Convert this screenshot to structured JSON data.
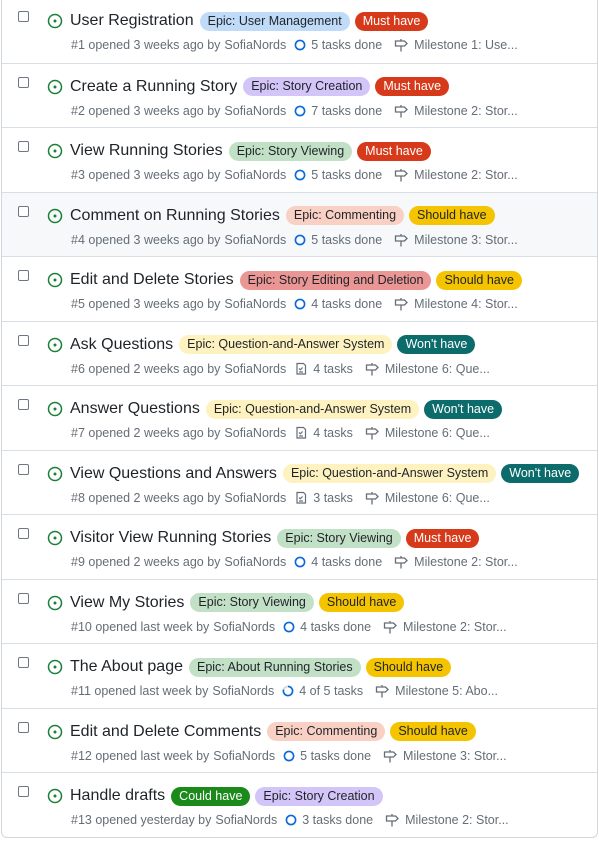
{
  "colors": {
    "open": "#1a7f37",
    "must": "#d73a1a",
    "should": "#f5c400",
    "wont": "#0c6b6b",
    "could": "#1b8a1b",
    "epic_user_mgmt": "#bfdbf7",
    "epic_story_creation": "#d4c5f9",
    "epic_story_viewing": "#c2e0c6",
    "epic_commenting": "#f9d0c4",
    "epic_editing_deletion": "#e99695",
    "epic_qa": "#fef2c0"
  },
  "issues": [
    {
      "title": "User Registration",
      "labels": [
        {
          "text": "Epic: User Management",
          "bg": "#bfdbf7",
          "fg": "#1f2328"
        },
        {
          "text": "Must have",
          "bg": "#d73a1a",
          "fg": "#ffffff"
        }
      ],
      "meta": "#1 opened 3 weeks ago by",
      "author": "SofiaNords",
      "tasks": "5 tasks done",
      "task_icon": "circle",
      "milestone": "Milestone 1: Use..."
    },
    {
      "title": "Create a Running Story",
      "labels": [
        {
          "text": "Epic: Story Creation",
          "bg": "#d4c5f9",
          "fg": "#1f2328"
        },
        {
          "text": "Must have",
          "bg": "#d73a1a",
          "fg": "#ffffff"
        }
      ],
      "meta": "#2 opened 3 weeks ago by",
      "author": "SofiaNords",
      "tasks": "7 tasks done",
      "task_icon": "circle",
      "milestone": "Milestone 2: Stor..."
    },
    {
      "title": "View Running Stories",
      "labels": [
        {
          "text": "Epic: Story Viewing",
          "bg": "#c2e0c6",
          "fg": "#1f2328"
        },
        {
          "text": "Must have",
          "bg": "#d73a1a",
          "fg": "#ffffff"
        }
      ],
      "meta": "#3 opened 3 weeks ago by",
      "author": "SofiaNords",
      "tasks": "5 tasks done",
      "task_icon": "circle",
      "milestone": "Milestone 2: Stor..."
    },
    {
      "title": "Comment on Running Stories",
      "labels": [
        {
          "text": "Epic: Commenting",
          "bg": "#f9d0c4",
          "fg": "#1f2328"
        },
        {
          "text": "Should have",
          "bg": "#f5c400",
          "fg": "#1f2328"
        }
      ],
      "meta": "#4 opened 3 weeks ago by",
      "author": "SofiaNords",
      "tasks": "5 tasks done",
      "task_icon": "circle",
      "milestone": "Milestone 3: Stor..."
    },
    {
      "title": "Edit and Delete Stories",
      "labels": [
        {
          "text": "Epic: Story Editing and Deletion",
          "bg": "#e99695",
          "fg": "#1f2328"
        },
        {
          "text": "Should have",
          "bg": "#f5c400",
          "fg": "#1f2328"
        }
      ],
      "meta": "#5 opened 3 weeks ago by",
      "author": "SofiaNords",
      "tasks": "4 tasks done",
      "task_icon": "circle",
      "milestone": "Milestone 4: Stor..."
    },
    {
      "title": "Ask Questions",
      "labels": [
        {
          "text": "Epic: Question-and-Answer System",
          "bg": "#fef2c0",
          "fg": "#1f2328"
        },
        {
          "text": "Won't have",
          "bg": "#0c6b6b",
          "fg": "#ffffff"
        }
      ],
      "meta": "#6 opened 2 weeks ago by",
      "author": "SofiaNords",
      "tasks": "4 tasks",
      "task_icon": "list",
      "milestone": "Milestone 6: Que..."
    },
    {
      "title": "Answer Questions",
      "labels": [
        {
          "text": "Epic: Question-and-Answer System",
          "bg": "#fef2c0",
          "fg": "#1f2328"
        },
        {
          "text": "Won't have",
          "bg": "#0c6b6b",
          "fg": "#ffffff"
        }
      ],
      "meta": "#7 opened 2 weeks ago by",
      "author": "SofiaNords",
      "tasks": "4 tasks",
      "task_icon": "list",
      "milestone": "Milestone 6: Que..."
    },
    {
      "title": "View Questions and Answers",
      "labels": [
        {
          "text": "Epic: Question-and-Answer System",
          "bg": "#fef2c0",
          "fg": "#1f2328"
        },
        {
          "text": "Won't have",
          "bg": "#0c6b6b",
          "fg": "#ffffff"
        }
      ],
      "meta": "#8 opened 2 weeks ago by",
      "author": "SofiaNords",
      "tasks": "3 tasks",
      "task_icon": "list",
      "milestone": "Milestone 6: Que..."
    },
    {
      "title": "Visitor View Running Stories",
      "labels": [
        {
          "text": "Epic: Story Viewing",
          "bg": "#c2e0c6",
          "fg": "#1f2328"
        },
        {
          "text": "Must have",
          "bg": "#d73a1a",
          "fg": "#ffffff"
        }
      ],
      "meta": "#9 opened 2 weeks ago by",
      "author": "SofiaNords",
      "tasks": "4 tasks done",
      "task_icon": "circle",
      "milestone": "Milestone 2: Stor..."
    },
    {
      "title": "View My Stories",
      "labels": [
        {
          "text": "Epic: Story Viewing",
          "bg": "#c2e0c6",
          "fg": "#1f2328"
        },
        {
          "text": "Should have",
          "bg": "#f5c400",
          "fg": "#1f2328"
        }
      ],
      "meta": "#10 opened last week by",
      "author": "SofiaNords",
      "tasks": "4 tasks done",
      "task_icon": "circle",
      "milestone": "Milestone 2: Stor..."
    },
    {
      "title": "The About page",
      "labels": [
        {
          "text": "Epic: About Running Stories",
          "bg": "#c2e0c6",
          "fg": "#1f2328"
        },
        {
          "text": "Should have",
          "bg": "#f5c400",
          "fg": "#1f2328"
        }
      ],
      "meta": "#11 opened last week by",
      "author": "SofiaNords",
      "tasks": "4 of 5 tasks",
      "task_icon": "progress",
      "milestone": "Milestone 5: Abo..."
    },
    {
      "title": "Edit and Delete Comments",
      "labels": [
        {
          "text": "Epic: Commenting",
          "bg": "#f9d0c4",
          "fg": "#1f2328"
        },
        {
          "text": "Should have",
          "bg": "#f5c400",
          "fg": "#1f2328"
        }
      ],
      "meta": "#12 opened last week by",
      "author": "SofiaNords",
      "tasks": "5 tasks done",
      "task_icon": "circle",
      "milestone": "Milestone 3: Stor..."
    },
    {
      "title": "Handle drafts",
      "labels": [
        {
          "text": "Could have",
          "bg": "#1b8a1b",
          "fg": "#ffffff"
        },
        {
          "text": "Epic: Story Creation",
          "bg": "#d4c5f9",
          "fg": "#1f2328"
        }
      ],
      "meta": "#13 opened yesterday by",
      "author": "SofiaNords",
      "tasks": "3 tasks done",
      "task_icon": "circle",
      "milestone": "Milestone 2: Stor..."
    }
  ]
}
